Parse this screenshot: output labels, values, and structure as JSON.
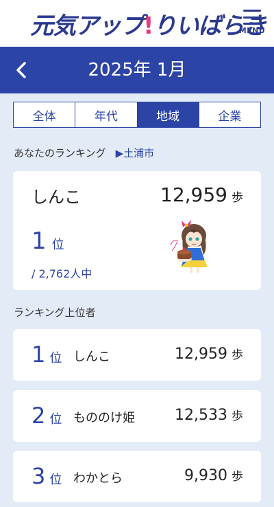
{
  "app": {
    "logo_main": "元気アップ",
    "logo_ex": "!",
    "logo_tail": "りいばらき",
    "menu_label": "MENU"
  },
  "period": {
    "title": "2025年 1月"
  },
  "tabs": [
    {
      "label": "全体"
    },
    {
      "label": "年代"
    },
    {
      "label": "地域",
      "active": true
    },
    {
      "label": "企業"
    }
  ],
  "my_ranking": {
    "section_label": "あなたのランキング",
    "region": "▶土浦市",
    "name": "しんこ",
    "steps": "12,959",
    "steps_unit": "歩",
    "rank": "1",
    "rank_unit": "位",
    "total": "/ 2,762人中"
  },
  "top_section_label": "ランキング上位者",
  "top_rankings": [
    {
      "rank": "1",
      "rank_unit": "位",
      "name": "しんこ",
      "steps": "12,959",
      "unit": "歩"
    },
    {
      "rank": "2",
      "rank_unit": "位",
      "name": "もののけ姫",
      "steps": "12,533",
      "unit": "歩"
    },
    {
      "rank": "3",
      "rank_unit": "位",
      "name": "わかとら",
      "steps": "9,930",
      "unit": "歩"
    }
  ],
  "colors": {
    "primary": "#2b44a6",
    "accent": "#e8397d",
    "background": "#e3ebf6"
  }
}
